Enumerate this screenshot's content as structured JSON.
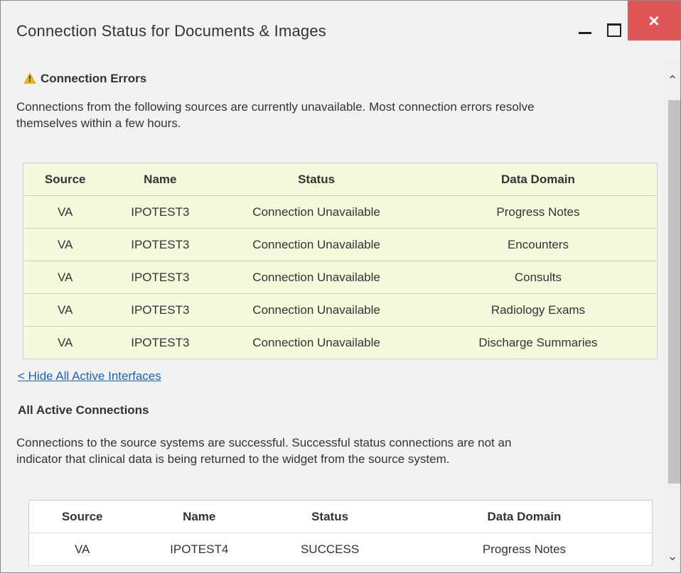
{
  "window": {
    "title": "Connection Status for Documents & Images",
    "close_glyph": "×"
  },
  "errors": {
    "heading": "Connection Errors",
    "icon": "warning-icon",
    "description_line1": "Connections from the following sources are currently unavailable. Most connection errors resolve",
    "description_line2": "themselves within a few hours.",
    "columns": [
      "Source",
      "Name",
      "Status",
      "Data Domain"
    ],
    "rows": [
      [
        "VA",
        "IPOTEST3",
        "Connection Unavailable",
        "Progress Notes"
      ],
      [
        "VA",
        "IPOTEST3",
        "Connection Unavailable",
        "Encounters"
      ],
      [
        "VA",
        "IPOTEST3",
        "Connection Unavailable",
        "Consults"
      ],
      [
        "VA",
        "IPOTEST3",
        "Connection Unavailable",
        "Radiology Exams"
      ],
      [
        "VA",
        "IPOTEST3",
        "Connection Unavailable",
        "Discharge Summaries"
      ]
    ]
  },
  "toggle_link": "< Hide All Active Interfaces",
  "active": {
    "heading": "All Active Connections",
    "description_line1": "Connections to the source systems are successful. Successful status connections are not an",
    "description_line2": "indicator that clinical data is being returned to the widget from the source system.",
    "columns": [
      "Source",
      "Name",
      "Status",
      "Data Domain"
    ],
    "rows": [
      [
        "VA",
        "IPOTEST4",
        "SUCCESS",
        "Progress Notes"
      ]
    ]
  },
  "colors": {
    "error_table_bg": "#f5fadc",
    "close_button": "#e05656",
    "link": "#1a63c7",
    "warning": "#e8b21d"
  }
}
